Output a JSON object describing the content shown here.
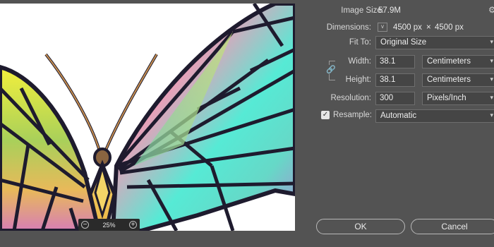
{
  "preview": {
    "zoom_label": "25%"
  },
  "dialog": {
    "image_size": {
      "label": "Image Size:",
      "value": "57.9M"
    },
    "dimensions": {
      "label": "Dimensions:",
      "width": "4500 px",
      "times": "×",
      "height": "4500 px"
    },
    "fit_to": {
      "label": "Fit To:",
      "value": "Original Size"
    },
    "width": {
      "label": "Width:",
      "value": "38.1",
      "unit": "Centimeters"
    },
    "height": {
      "label": "Height:",
      "value": "38.1",
      "unit": "Centimeters"
    },
    "resolution": {
      "label": "Resolution:",
      "value": "300",
      "unit": "Pixels/Inch"
    },
    "resample": {
      "label": "Resample:",
      "checked": true,
      "value": "Automatic"
    },
    "ok_label": "OK",
    "cancel_label": "Cancel"
  }
}
